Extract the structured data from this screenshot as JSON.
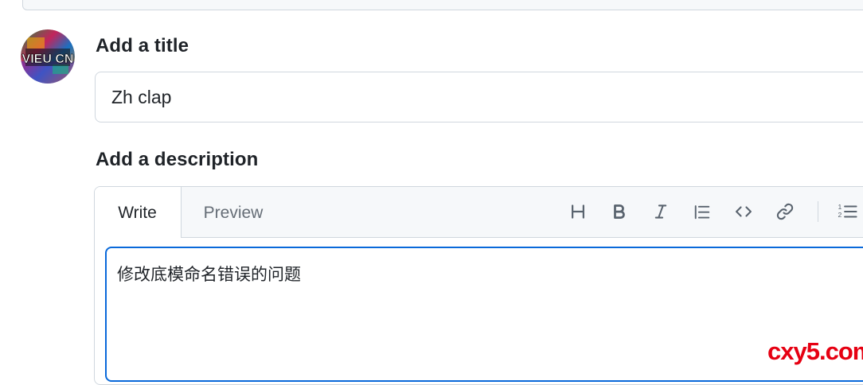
{
  "title_section": {
    "label": "Add a title",
    "input_value": "Zh clap"
  },
  "description_section": {
    "label": "Add a description",
    "tabs": [
      {
        "label": "Write",
        "active": true
      },
      {
        "label": "Preview",
        "active": false
      }
    ],
    "toolbar_icons": [
      "heading-icon",
      "bold-icon",
      "italic-icon",
      "quote-icon",
      "code-icon",
      "link-icon",
      "ordered-list-icon"
    ],
    "body_text": "修改底模命名错误的问题"
  },
  "avatar": {
    "text": "VIEU CN",
    "icon": "avatar-image"
  },
  "watermark": "cxy5.com",
  "colors": {
    "accent": "#0969da",
    "border": "#d0d7de",
    "header_bg": "#f6f8fa",
    "muted_text": "#656d76",
    "icon_color": "#59636e",
    "watermark": "#e60012"
  }
}
